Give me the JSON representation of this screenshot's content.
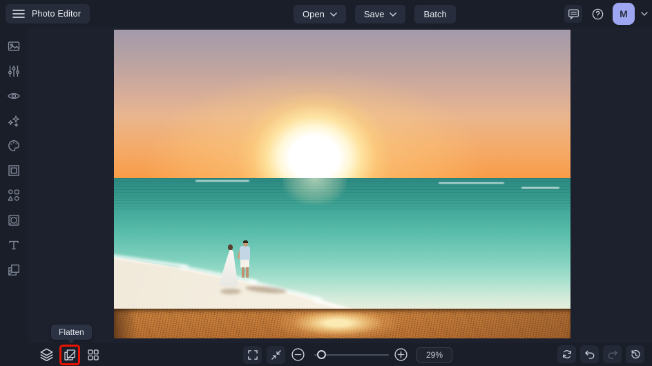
{
  "topbar": {
    "title": "Photo Editor",
    "open_label": "Open",
    "save_label": "Save",
    "batch_label": "Batch",
    "avatar_initial": "M"
  },
  "sidebar": {
    "items": [
      {
        "id": "photo-manager",
        "icon": "image-icon"
      },
      {
        "id": "edit",
        "icon": "sliders-icon"
      },
      {
        "id": "retouch",
        "icon": "eye-icon"
      },
      {
        "id": "effects",
        "icon": "sparkles-icon"
      },
      {
        "id": "artsy",
        "icon": "palette-icon"
      },
      {
        "id": "frames",
        "icon": "frame-icon"
      },
      {
        "id": "graphics",
        "icon": "shapes-icon"
      },
      {
        "id": "textures",
        "icon": "texture-icon"
      },
      {
        "id": "text",
        "icon": "text-icon"
      },
      {
        "id": "overlays",
        "icon": "overlays-icon"
      }
    ]
  },
  "bottombar": {
    "flatten_tooltip": "Flatten",
    "zoom_level": "29%",
    "left_icons": [
      "layers-icon",
      "flatten-icon",
      "grid-icon"
    ],
    "center_icons": [
      "fullscreen-icon",
      "fit-screen-icon",
      "zoom-out-icon",
      "zoom-in-icon"
    ],
    "right_icons": [
      "sync-icon",
      "undo-icon",
      "redo-icon",
      "history-icon"
    ]
  },
  "canvas": {
    "zoom_percent": 29,
    "description": "Couple in white clothing walking hand in hand on a white sand beach at sunset, turquoise sea and bright sun above the horizon; strip of sunlit orange wet sand along the bottom"
  },
  "colors": {
    "chrome_bg": "#1a1e28",
    "canvas_bg": "#1d212d",
    "button_bg": "#272d3c",
    "avatar_bg": "#9fa6f1",
    "highlight_red": "#e81300",
    "tooltip_bg": "#2b3243"
  }
}
